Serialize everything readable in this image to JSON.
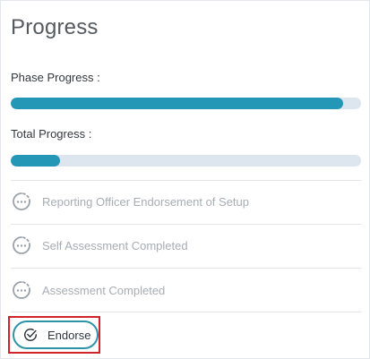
{
  "panel": {
    "title": "Progress"
  },
  "phase_progress": {
    "label": "Phase Progress :",
    "value_percent": 95
  },
  "total_progress": {
    "label": "Total Progress :",
    "value_percent": 14
  },
  "steps": [
    {
      "label": "Reporting Officer Endorsement of Setup",
      "icon": "pending-clock-icon"
    },
    {
      "label": "Self Assessment Completed",
      "icon": "pending-clock-icon"
    },
    {
      "label": "Assessment Completed",
      "icon": "pending-clock-icon"
    }
  ],
  "endorse_button": {
    "label": "Endorse",
    "icon": "check-circle-icon"
  },
  "colors": {
    "progress_fill": "#2497b6",
    "progress_track": "#dde5ee",
    "button_border": "#2f93a8",
    "highlight": "#d3232a"
  }
}
